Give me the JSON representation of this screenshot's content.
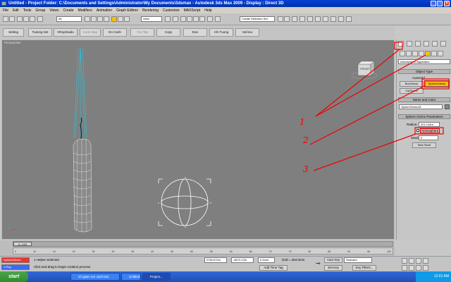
{
  "window": {
    "title": "Untitled   - Project Folder: C:\\Documents and Settings\\Administrator\\My Documents\\3dsmax    - Autodesk 3ds Max  2009       - Display : Direct 3D"
  },
  "menu": [
    "File",
    "Edit",
    "Tools",
    "Group",
    "Views",
    "Create",
    "Modifiers",
    "Animation",
    "Graph Editors",
    "Rendering",
    "Customize",
    "MAXScript",
    "Help"
  ],
  "main_toolbar": {
    "filter_select": "All",
    "view_select": "View",
    "selection_set": "Create Selection Set"
  },
  "custom_toolbar": [
    "Setting",
    "Tudong Set",
    "VRayStudio",
    "Camt Map",
    "Do Canh",
    "Tuo Tap",
    "Copy",
    "Dan",
    "Chi Tuong",
    "Vat lieu"
  ],
  "viewport": {
    "label": "Perspective",
    "cube_label": "FRONT"
  },
  "command_panel": {
    "category_select": "Atmospheric Apparatus",
    "object_type_header": "Object Type",
    "autogrid_label": "AutoGrid",
    "buttons": [
      "BoxGizmo",
      "SphereGizmo",
      "CylGizmo"
    ],
    "name_color_header": "Name and Color",
    "name_value": "SphereGizmo01",
    "params_header": "Sphere Gizmo Parameters",
    "radius_label": "Radius:",
    "radius_value": "321.144m",
    "hemisphere_label": "Hemisphere",
    "seed_label": "Seed:",
    "seed_value": "0",
    "new_seed": "New Seed"
  },
  "timeline": {
    "frame_counter": "0 / 100",
    "ticks": [
      "0",
      "10",
      "15",
      "20",
      "25",
      "30",
      "35",
      "40",
      "45",
      "50",
      "55",
      "60",
      "65",
      "70",
      "75",
      "80",
      "85",
      "90",
      "95",
      "100"
    ]
  },
  "status": {
    "listener": "SphereGizmo",
    "vray_tab": "V-Ray",
    "selected": "1 Helper Selected",
    "prompt": "Click and drag to begin creation process",
    "x_value": "2750.672m",
    "y_value": "-8074.123r",
    "z_value": "0.0mm",
    "grid": "Grid = 254.0mm",
    "add_time_tag": "Add Time Tag",
    "auto_key": "Auto Key",
    "auto_select": "Selected",
    "set_key": "Set Key",
    "key_filters": "Key Filters..."
  },
  "taskbar": {
    "start": "start",
    "tasks": [
      "chi giam em cach lam",
      "Untitled",
      "Project..."
    ],
    "time": "12:01 AM"
  },
  "annotations": [
    "1",
    "2",
    "3"
  ],
  "colors": {
    "annotation": "#ee0000",
    "viewport_bg": "#7f7f7f",
    "highlight": "#f5c000"
  }
}
